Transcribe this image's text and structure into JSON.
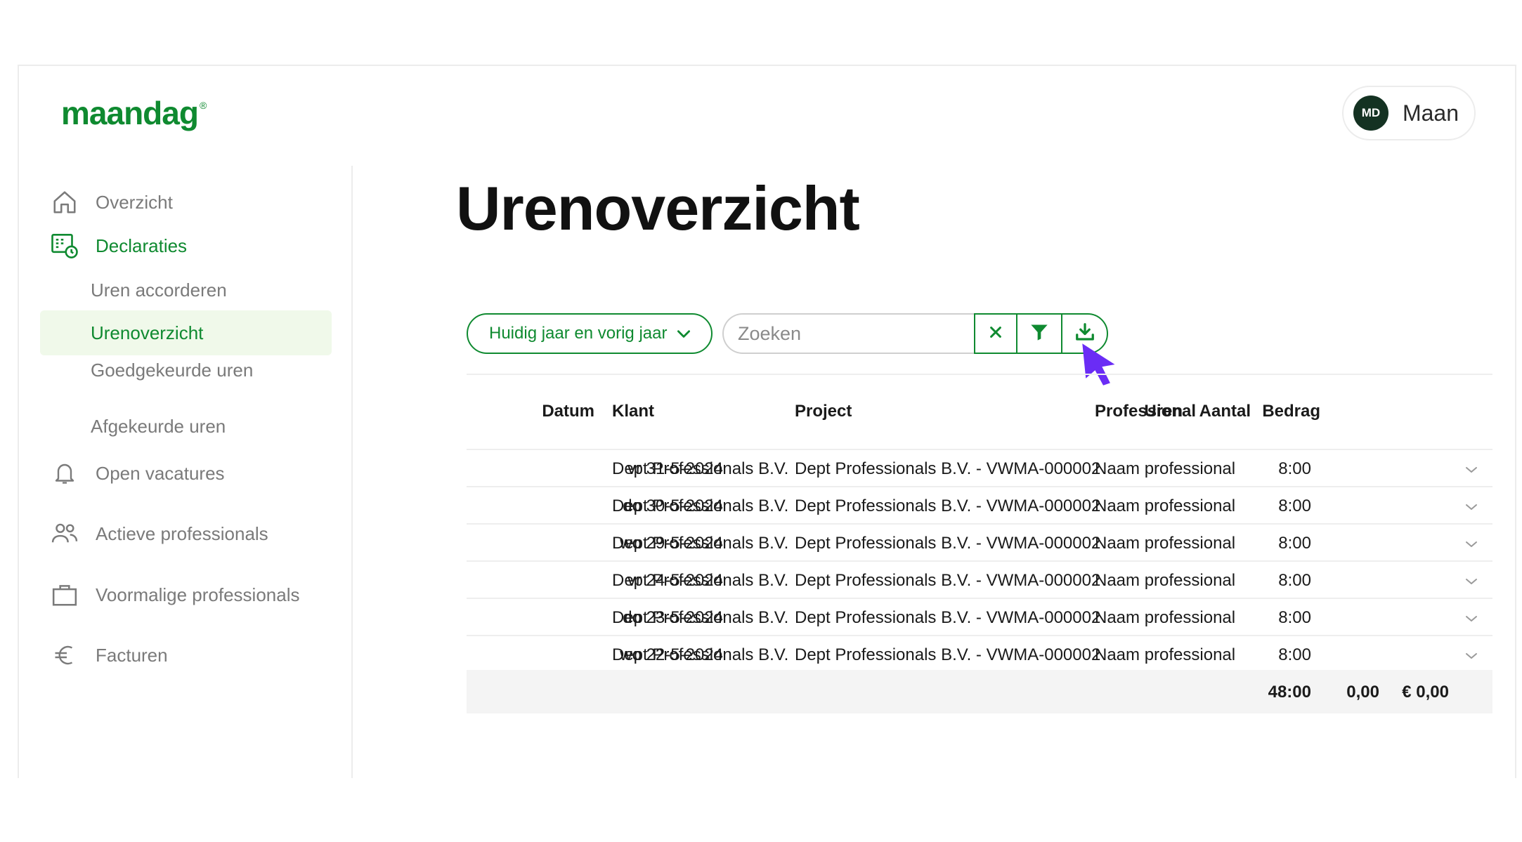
{
  "brand": {
    "name": "maandag",
    "mark": "®",
    "color": "#0f8a30"
  },
  "user": {
    "initials": "MD",
    "name": "Maan"
  },
  "sidebar": {
    "items": [
      {
        "label": "Overzicht",
        "icon": "home-icon"
      },
      {
        "label": "Declaraties",
        "icon": "declarations-icon",
        "active": true
      },
      {
        "label": "Open vacatures",
        "icon": "bell-icon"
      },
      {
        "label": "Actieve professionals",
        "icon": "users-icon"
      },
      {
        "label": "Voormalige professionals",
        "icon": "briefcase-icon"
      },
      {
        "label": "Facturen",
        "icon": "euro-icon"
      }
    ],
    "subitems": [
      {
        "label": "Uren accorderen"
      },
      {
        "label": "Urenoverzicht",
        "active": true
      },
      {
        "label": "Goedgekeurde uren"
      },
      {
        "label": "Afgekeurde uren"
      }
    ]
  },
  "page": {
    "title": "Urenoverzicht"
  },
  "toolbar": {
    "period": "Huidig jaar en vorig jaar",
    "search_placeholder": "Zoeken",
    "clear_icon": "close-icon",
    "filter_icon": "filter-icon",
    "download_icon": "download-icon"
  },
  "table": {
    "columns": [
      "Datum",
      "Klant",
      "Project",
      "Professional",
      "Uren",
      "Aantal",
      "Bedrag"
    ],
    "rows": [
      {
        "datum": "vr 31-5-2024",
        "klant": "Dept Professionals B.V.",
        "project": "Dept Professionals B.V. - VWMA-000002",
        "professional": "Naam professional",
        "uren": "8:00"
      },
      {
        "datum": "do 30-5-2024",
        "klant": "Dept Professionals B.V.",
        "project": "Dept Professionals B.V. - VWMA-000002",
        "professional": "Naam professional",
        "uren": "8:00"
      },
      {
        "datum": "wo 29-5-2024",
        "klant": "Dept Professionals B.V.",
        "project": "Dept Professionals B.V. - VWMA-000002",
        "professional": "Naam professional",
        "uren": "8:00"
      },
      {
        "datum": "vr 24-5-2024",
        "klant": "Dept Professionals B.V.",
        "project": "Dept Professionals B.V. - VWMA-000002",
        "professional": "Naam professional",
        "uren": "8:00"
      },
      {
        "datum": "do 23-5-2024",
        "klant": "Dept Professionals B.V.",
        "project": "Dept Professionals B.V. - VWMA-000002",
        "professional": "Naam professional",
        "uren": "8:00"
      },
      {
        "datum": "wo 22-5-2024",
        "klant": "Dept Professionals B.V.",
        "project": "Dept Professionals B.V. - VWMA-000002",
        "professional": "Naam professional",
        "uren": "8:00"
      }
    ],
    "totals": {
      "uren": "48:00",
      "aantal": "0,00",
      "bedrag": "€ 0,00"
    }
  },
  "colors": {
    "accent": "#0f8a30",
    "cursor": "#6a2cf5",
    "active_bg": "#f0f9ea"
  }
}
